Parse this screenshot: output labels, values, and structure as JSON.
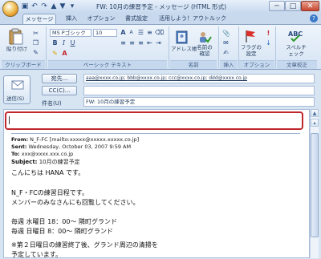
{
  "window": {
    "title": "FW: 10月の練習予定 - メッセージ (HTML 形式)",
    "minimize": "─",
    "maximize": "□",
    "close": "✕"
  },
  "tabs": [
    {
      "label": "メッセージ",
      "active": true
    },
    {
      "label": "挿入",
      "active": false
    },
    {
      "label": "オプション",
      "active": false
    },
    {
      "label": "書式設定",
      "active": false
    },
    {
      "label": "活用しよう！アウトルック",
      "active": false
    }
  ],
  "ribbon": {
    "clipboard": {
      "paste": "貼り付け",
      "group": "クリップボード"
    },
    "font": {
      "name": "MS Pゴシック",
      "size": "10",
      "group": "ベーシック テキスト"
    },
    "names": {
      "address_book": "アドレス帳",
      "check_names": "名前の確認",
      "group": "名前"
    },
    "insert": {
      "group": "挿入"
    },
    "options": {
      "follow_up": "フラグの設定",
      "group": "オプション"
    },
    "proofing": {
      "spelling": "スペルチェック",
      "group": "文章校正"
    }
  },
  "compose": {
    "send": "送信(S)",
    "to_button": "宛先...",
    "cc_button": "CC(C)...",
    "subject_label": "件名(U)",
    "to_value": "aaa@xxxx.co.jp; bbb@xxxx.co.jp; ccc@xxxx.co.jp; ddd@xxxx.co.jp",
    "cc_value": "",
    "subject_value": "FW: 10月の練習予定"
  },
  "message": {
    "from_label": "From:",
    "from_value": "N_F-FC [mailto:xxxxx@xxxxx.xxxxx.co.jp]",
    "sent_label": "Sent:",
    "sent_value": "Wednesday, October 03, 2007 9:59 AM",
    "to_label": "To:",
    "to_value": "xxx@xxxx.xxx.co.jp",
    "subject_label": "Subject:",
    "subject_value": "10月の練習予定",
    "lines": [
      "こんにちは HANA です。",
      "",
      "N_F・FCの練習日程です。",
      "メンバーのみなさんにも回覧してください。",
      "",
      "毎週 水曜日 18：00～ 隣町グランド",
      "毎週 日曜日  8：00～ 隣町グランド",
      "",
      "※第２日曜日の練習終了後、グランド周辺の清掃を",
      "予定しています。"
    ]
  },
  "colors": {
    "highlight": "#c0262d",
    "ribbon": "#d6e4f4"
  }
}
